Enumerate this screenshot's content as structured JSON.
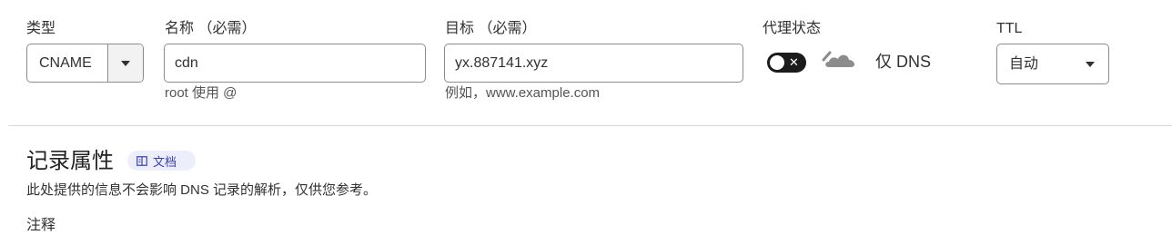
{
  "form": {
    "type": {
      "label": "类型",
      "value": "CNAME"
    },
    "name": {
      "label": "名称 （必需）",
      "value": "cdn",
      "hint": "root 使用 @"
    },
    "target": {
      "label": "目标 （必需）",
      "value": "yx.887141.xyz",
      "hint": "例如，www.example.com"
    },
    "proxy": {
      "label": "代理状态",
      "toggle_symbol": "✕",
      "enabled": false,
      "status_text": "仅 DNS",
      "icon": "cloud-dns-only-icon"
    },
    "ttl": {
      "label": "TTL",
      "value": "自动"
    }
  },
  "record_attributes": {
    "title": "记录属性",
    "doc_badge": "文档",
    "doc_icon": "book-icon",
    "description": "此处提供的信息不会影响 DNS 记录的解析，仅供您参考。",
    "comment_label": "注释"
  },
  "colors": {
    "accent_badge_bg": "#eceefc",
    "accent_badge_text": "#3a40b8",
    "toggle_off": "#1b1b1b",
    "cloud_gray": "#8c8c8c"
  }
}
